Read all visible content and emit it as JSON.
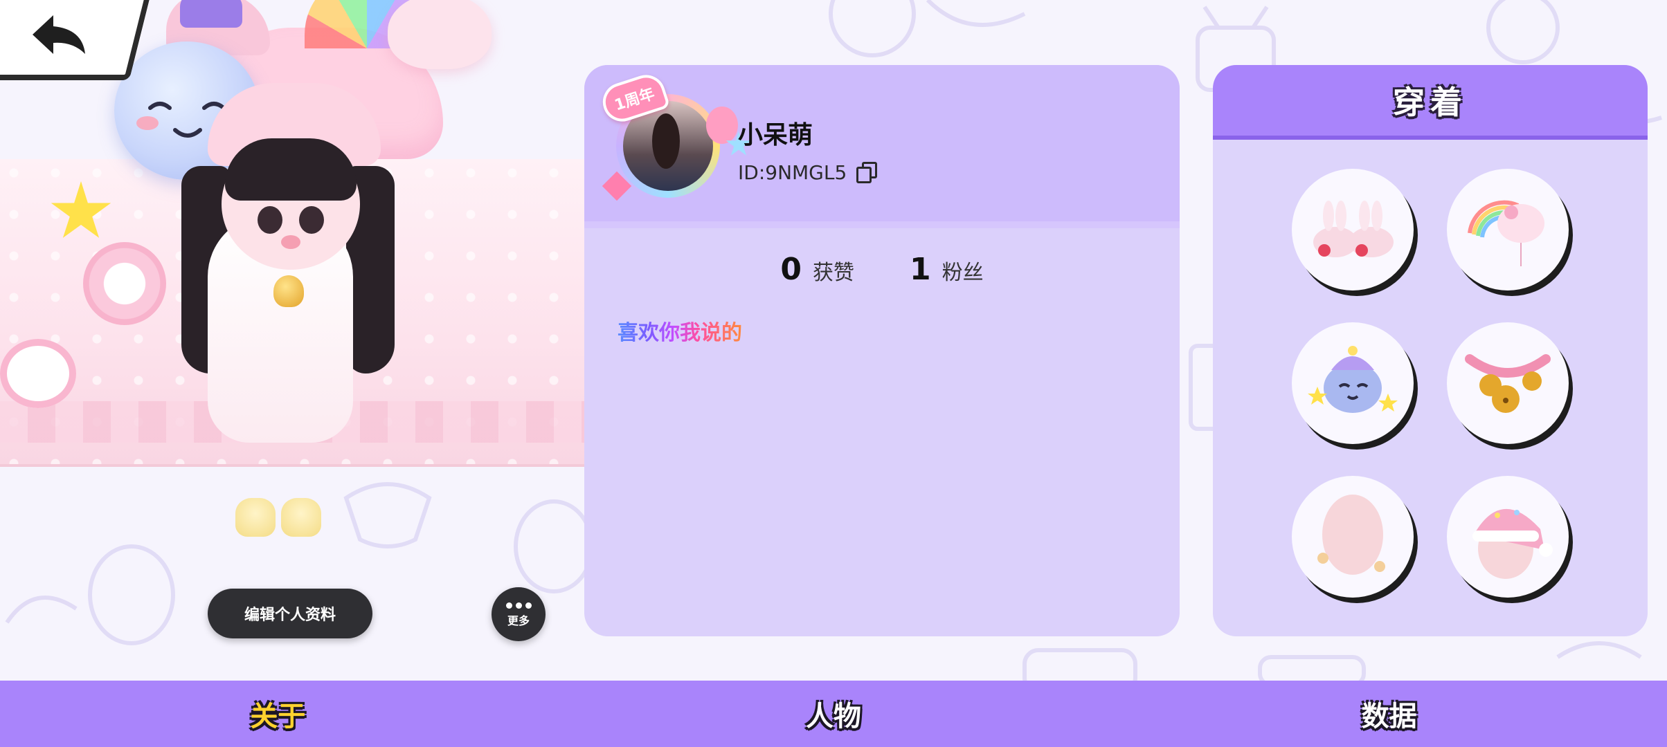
{
  "nav": {
    "back_icon": "back-arrow-icon"
  },
  "actions": {
    "edit_profile_label": "编辑个人资料",
    "more_label": "更多"
  },
  "profile": {
    "badge_text": "1周年",
    "username": "小呆萌",
    "user_id": "ID:9NMGL5",
    "stats": [
      {
        "value": "0",
        "label": "获赞"
      },
      {
        "value": "1",
        "label": "粉丝"
      }
    ],
    "bio": "喜欢你我说的"
  },
  "wearing": {
    "title": "穿着",
    "items": [
      {
        "icon": "bunny-slippers-icon"
      },
      {
        "icon": "rainbow-unicorn-balloon-icon"
      },
      {
        "icon": "moon-plush-icon"
      },
      {
        "icon": "bell-collar-icon"
      },
      {
        "icon": "face-base-icon"
      },
      {
        "icon": "pink-nightcap-icon"
      }
    ]
  },
  "tabs": [
    {
      "label": "关于",
      "active": true
    },
    {
      "label": "人物",
      "active": false
    },
    {
      "label": "数据",
      "active": false
    }
  ],
  "colors": {
    "accent": "#a984fb",
    "active_tab": "#ffd22e",
    "card_bg": "#dbd0fb"
  }
}
